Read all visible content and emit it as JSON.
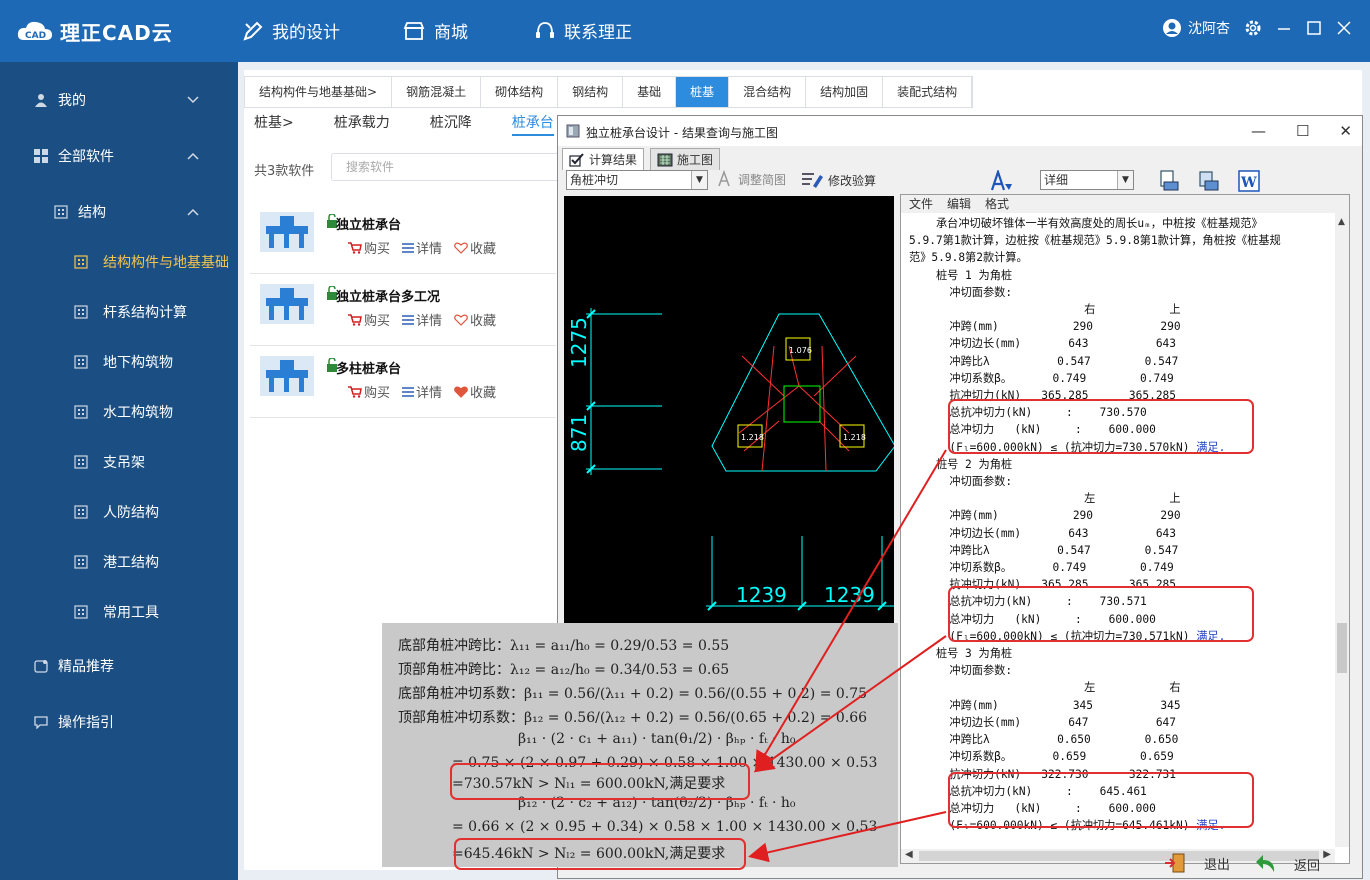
{
  "app": {
    "name": "理正CAD云"
  },
  "nav": {
    "design": "我的设计",
    "shop": "商城",
    "contact": "联系理正"
  },
  "user": {
    "name": "沈阿杏"
  },
  "sidebar": {
    "me": "我的",
    "all_software": "全部软件",
    "structure": "结构",
    "sub_items": [
      "结构构件与地基基础",
      "杆系结构计算",
      "地下构筑物",
      "水工构筑物",
      "支吊架",
      "人防结构",
      "港工结构",
      "常用工具"
    ],
    "recommend": "精品推荐",
    "guide": "操作指引"
  },
  "category_tabs": [
    "结构构件与地基基础>",
    "钢筋混凝土",
    "砌体结构",
    "钢结构",
    "基础",
    "桩基",
    "混合结构",
    "结构加固",
    "装配式结构"
  ],
  "sub_tabs": [
    "桩基>",
    "桩承载力",
    "桩沉降",
    "桩承台"
  ],
  "software_count": "共3款软件",
  "search_placeholder": "搜索软件",
  "products": [
    {
      "name": "独立桩承台",
      "buy": "购买",
      "detail": "详情",
      "fav": "收藏"
    },
    {
      "name": "独立桩承台多工况",
      "buy": "购买",
      "detail": "详情",
      "fav": "收藏"
    },
    {
      "name": "多柱桩承台",
      "buy": "购买",
      "detail": "详情",
      "fav": "收藏"
    }
  ],
  "dialog": {
    "title": "独立桩承台设计 - 结果查询与施工图",
    "tab_results": "计算结果",
    "tab_drawing": "施工图",
    "check_select": "角桩冲切",
    "adjust": "调整简图",
    "modify": "修改验算",
    "detail_select": "详细",
    "menu": [
      "文件",
      "编辑",
      "格式"
    ],
    "exit": "退出",
    "back": "返回"
  },
  "cad": {
    "dim_left_top": "1275",
    "dim_left_bottom": "871",
    "dim_bottom_left": "1239",
    "dim_bottom_right": "1239",
    "pile_1": "1.076",
    "pile_2": "1.218",
    "pile_3": "1.218"
  },
  "report_lines": [
    "    承台冲切破坏锥体一半有效高度处的周长uₘ，中桩按《桩基规范》",
    "5.9.7第1款计算，边桩按《桩基规范》5.9.8第1款计算，角桩按《桩基规",
    "范》5.9.8第2款计算。",
    "    桩号 1 为角桩",
    "      冲切面参数:",
    "                          右           上",
    "      冲跨(mm)           290          290",
    "      冲切边长(mm)       643          643",
    "      冲跨比λ          0.547        0.547",
    "      冲切系数β。      0.749        0.749",
    "      抗冲切力(kN)   365.285      365.285",
    "      总抗冲切力(kN)     :    730.570",
    "      总冲切力   (kN)     :    600.000",
    "      (Fₗ=600.000kN) ≤ (抗冲切力=730.570kN) 满足.",
    "    桩号 2 为角桩",
    "      冲切面参数:",
    "                          左           上",
    "      冲跨(mm)           290          290",
    "      冲切边长(mm)       643          643",
    "      冲跨比λ          0.547        0.547",
    "      冲切系数β。      0.749        0.749",
    "      抗冲切力(kN)   365.285      365.285",
    "      总抗冲切力(kN)     :    730.571",
    "      总冲切力   (kN)     :    600.000",
    "      (Fₗ=600.000kN) ≤ (抗冲切力=730.571kN) 满足.",
    "    桩号 3 为角桩",
    "      冲切面参数:",
    "                          左           右",
    "      冲跨(mm)           345          345",
    "      冲切边长(mm)       647          647",
    "      冲跨比λ          0.650        0.650",
    "      冲切系数β。      0.659        0.659",
    "      抗冲切力(kN)   322.730      322.731",
    "      总抗冲切力(kN)     :    645.461",
    "      总冲切力   (kN)     :    600.000",
    "      (Fₗ=600.000kN) ≤ (抗冲切力=645.461kN) 满足."
  ],
  "textbook_lines": [
    "底部角桩冲跨比：λ₁₁ = a₁₁/h₀ = 0.29/0.53 = 0.55",
    "顶部角桩冲跨比：λ₁₂ = a₁₂/h₀ = 0.34/0.53 = 0.65",
    "底部角桩冲切系数：β₁₁ = 0.56/(λ₁₁ + 0.2) = 0.56/(0.55 + 0.2) = 0.75",
    "顶部角桩冲切系数：β₁₂ = 0.56/(λ₁₂ + 0.2) = 0.56/(0.65 + 0.2) = 0.66",
    "β₁₁ · (2 · c₁ + a₁₁) · tan(θ₁/2) · βₕₚ · fₜ · h₀",
    "= 0.75 × (2 × 0.97 + 0.29) × 0.58 × 1.00 × 1430.00 × 0.53",
    "=730.57kN > Nₗ₁ = 600.00kN,满足要求",
    "β₁₂ · (2 · c₂ + a₁₂) · tan(θ₂/2) · βₕₚ · fₜ · h₀",
    "= 0.66 × (2 × 0.95 + 0.34) × 0.58 × 1.00 × 1430.00 × 0.53",
    "=645.46kN > Nₗ₂ = 600.00kN,满足要求"
  ],
  "colors": {
    "brand": "#1d69b5",
    "sidebar": "#1b4f84",
    "active_tab": "#2d8cde",
    "highlight": "#e03030",
    "active_sidebar_text": "#f5c44e"
  }
}
